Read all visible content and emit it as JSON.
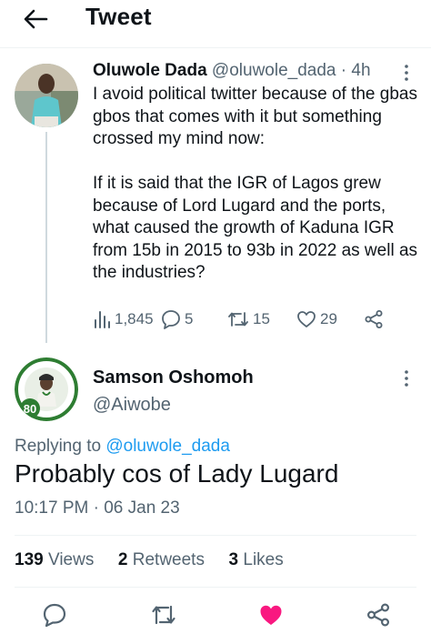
{
  "header": {
    "title": "Tweet"
  },
  "parent_tweet": {
    "name": "Oluwole Dada",
    "handle": "@oluwole_dada",
    "separator": "·",
    "time": "4h",
    "text_p1": "I avoid political twitter because of the gbas gbos that comes with it but something crossed my mind now:",
    "text_p2": "If it is said that the IGR of Lagos grew because of Lord Lugard and the ports, what caused the growth of Kaduna IGR from 15b in 2015 to 93b in 2022 as well as the industries?",
    "views": "1,845",
    "replies": "5",
    "retweets": "15",
    "likes": "29"
  },
  "reply_tweet": {
    "name": "Samson Oshomoh",
    "handle": "@Aiwobe",
    "avatar_badge": "80",
    "avatar_ring_text": "PRESIDENT MUHAMMADU BUHARI",
    "replying_to_label": "Replying to",
    "replying_to_handle": "@oluwole_dada",
    "text": "Probably cos of Lady Lugard",
    "timestamp": "10:17 PM · 06 Jan 23",
    "views_count": "139",
    "views_label": "Views",
    "retweets_count": "2",
    "retweets_label": "Retweets",
    "likes_count": "3",
    "likes_label": "Likes"
  },
  "colors": {
    "text": "#0f1419",
    "secondary": "#536471",
    "link": "#1d9bf0",
    "like_active": "#f91880",
    "divider": "#eff3f4",
    "avatar_green": "#2e7d32"
  },
  "icons": {
    "back": "arrow-left-icon",
    "more": "more-vertical-icon",
    "views": "analytics-icon",
    "reply": "reply-icon",
    "retweet": "retweet-icon",
    "like": "heart-icon",
    "share": "share-icon"
  }
}
